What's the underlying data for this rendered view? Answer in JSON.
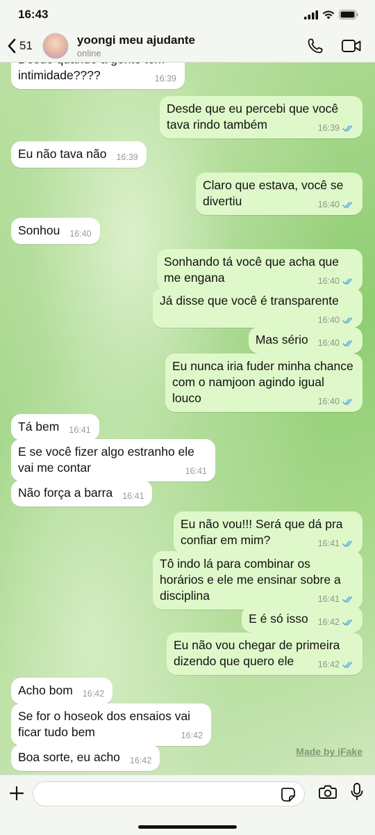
{
  "status_bar": {
    "time": "16:43"
  },
  "header": {
    "back_count": "51",
    "contact_name": "yoongi meu ajudante",
    "contact_status": "online"
  },
  "messages": [
    {
      "dir": "in",
      "text": "Desde quando a gente tem intimidade????",
      "time": "16:39"
    },
    {
      "dir": "out",
      "text": "Desde que eu percebi que você tava rindo também",
      "time": "16:39",
      "read": true
    },
    {
      "dir": "in",
      "text": "Eu não tava não",
      "time": "16:39"
    },
    {
      "dir": "out",
      "text": "Claro que estava, você se divertiu",
      "time": "16:40",
      "read": true
    },
    {
      "dir": "in",
      "text": "Sonhou",
      "time": "16:40"
    },
    {
      "dir": "out",
      "text": "Sonhando tá você que acha que me engana",
      "time": "16:40",
      "read": true
    },
    {
      "dir": "out",
      "text": "Já disse que você é transparente",
      "time": "16:40",
      "read": true
    },
    {
      "dir": "out",
      "text": "Mas sério",
      "time": "16:40",
      "read": true
    },
    {
      "dir": "out",
      "text": "Eu nunca iria fuder minha chance com o namjoon agindo igual louco",
      "time": "16:40",
      "read": true
    },
    {
      "dir": "in",
      "text": "Tá bem",
      "time": "16:41"
    },
    {
      "dir": "in",
      "text": "E se você fizer algo estranho ele vai me contar",
      "time": "16:41"
    },
    {
      "dir": "in",
      "text": "Não força a barra",
      "time": "16:41"
    },
    {
      "dir": "out",
      "text": "Eu não vou!!! Será que dá pra confiar em mim?",
      "time": "16:41",
      "read": true
    },
    {
      "dir": "out",
      "text": "Tô indo lá para combinar os horários e ele me ensinar sobre a disciplina",
      "time": "16:41",
      "read": true
    },
    {
      "dir": "out",
      "text": "E é só isso",
      "time": "16:42",
      "read": true
    },
    {
      "dir": "out",
      "text": "Eu não vou chegar de primeira dizendo que quero ele",
      "time": "16:42",
      "read": true
    },
    {
      "dir": "in",
      "text": "Acho bom",
      "time": "16:42"
    },
    {
      "dir": "in",
      "text": "Se for o hoseok dos ensaios vai ficar tudo bem",
      "time": "16:42"
    },
    {
      "dir": "in",
      "text": "Boa sorte, eu acho",
      "time": "16:42"
    }
  ],
  "watermark": "Made by iFake",
  "composer": {
    "placeholder": ""
  },
  "icons": {
    "back": "chevron-left-icon",
    "phone": "phone-icon",
    "video": "video-camera-icon",
    "plus": "plus-icon",
    "sticker": "sticker-icon",
    "camera": "camera-icon",
    "mic": "microphone-icon",
    "read_ticks": "double-check-icon"
  },
  "colors": {
    "outgoing_bubble": "#dff8c9",
    "incoming_bubble": "#ffffff",
    "read_ticks": "#4fa3e8",
    "chat_background": "#9fd585"
  }
}
